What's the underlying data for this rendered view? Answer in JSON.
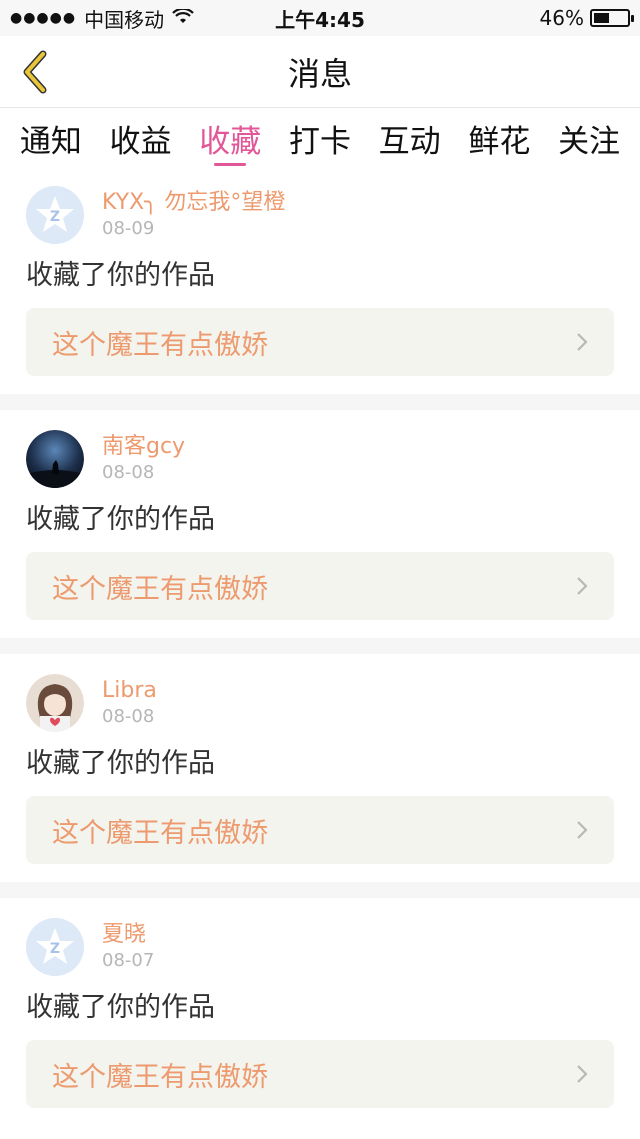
{
  "status_bar": {
    "carrier": "中国移动",
    "time": "上午4:45",
    "battery": "46%",
    "battery_level": 0.46
  },
  "nav": {
    "title": "消息"
  },
  "tabs": [
    {
      "label": "通知",
      "active": false
    },
    {
      "label": "收益",
      "active": false
    },
    {
      "label": "收藏",
      "active": true
    },
    {
      "label": "打卡",
      "active": false
    },
    {
      "label": "互动",
      "active": false
    },
    {
      "label": "鲜花",
      "active": false
    },
    {
      "label": "关注",
      "active": false
    }
  ],
  "items": [
    {
      "user": "KYX╮ 勿忘我°望橙",
      "date": "08-09",
      "action": "收藏了你的作品",
      "work": "这个魔王有点傲娇",
      "avatar": "default-z-avatar"
    },
    {
      "user": "南客gcy",
      "date": "08-08",
      "action": "收藏了你的作品",
      "work": "这个魔王有点傲娇",
      "avatar": "wolf-night-avatar"
    },
    {
      "user": "Libra",
      "date": "08-08",
      "action": "收藏了你的作品",
      "work": "这个魔王有点傲娇",
      "avatar": "girl-avatar"
    },
    {
      "user": "夏晓",
      "date": "08-07",
      "action": "收藏了你的作品",
      "work": "这个魔王有点傲娇",
      "avatar": "default-z-avatar"
    }
  ],
  "colors": {
    "accent_pink": "#e25797",
    "name_orange": "#ec9a6e",
    "back_yellow": "#e8c53a"
  }
}
